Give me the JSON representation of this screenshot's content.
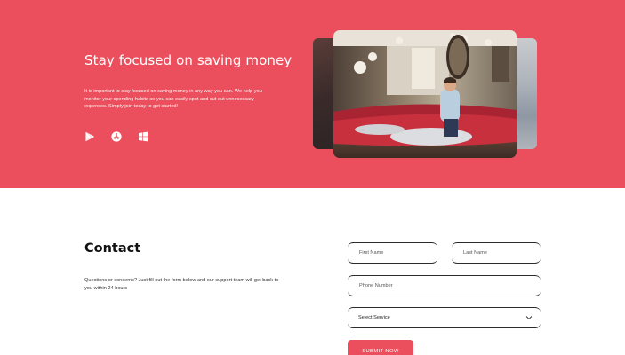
{
  "hero": {
    "title": "Stay focused on saving money",
    "text": "It is important to stay focused on saving money in any way you can. We help you monitor your spending habits so you can easily spot and cut out unnecessary expenses. Simply join today to get started!",
    "background": "#eb4f5d",
    "stores": [
      {
        "icon": "google-play-icon"
      },
      {
        "icon": "app-store-icon"
      },
      {
        "icon": "windows-icon"
      }
    ]
  },
  "contact": {
    "title": "Contact",
    "text": "Questions or concerns? Just fill out the form below and our support team will get back to you within 24 hours",
    "form": {
      "first_name": "First Name",
      "last_name": "Last Name",
      "phone": "Phone Number",
      "service": "Select Service",
      "submit": "SUBMIT NOW"
    }
  }
}
